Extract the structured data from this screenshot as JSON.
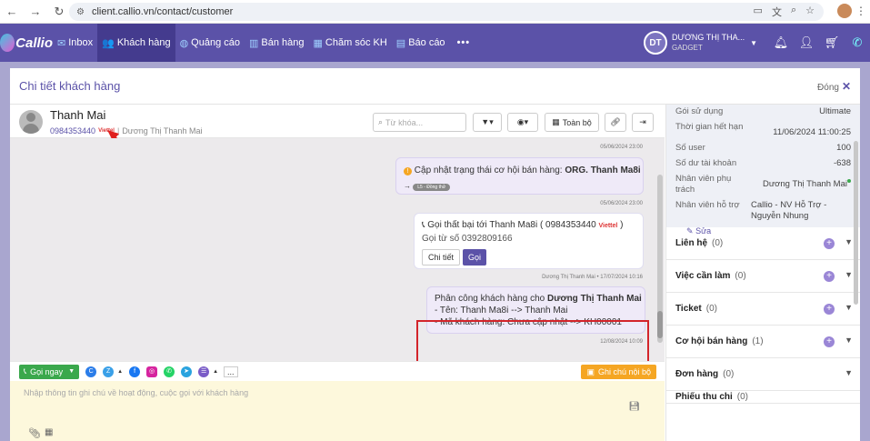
{
  "browser": {
    "url": "client.callio.vn/contact/customer"
  },
  "nav": {
    "logo": "Callio",
    "items": [
      "Inbox",
      "Khách hàng",
      "Quảng cáo",
      "Bán hàng",
      "Chăm sóc KH",
      "Báo cáo"
    ],
    "avatar": "DT",
    "user_name": "DƯƠNG THỊ THA...",
    "user_sub": "GADGET"
  },
  "panel": {
    "title": "Chi tiết khách hàng",
    "close": "Đóng"
  },
  "contact": {
    "name": "Thanh Mai",
    "phone": "0984353440",
    "carrier": "Viettel",
    "owner": "Dương Thị Thanh Mai"
  },
  "toolbar": {
    "search_placeholder": "Từ khóa...",
    "all": "Toàn bộ"
  },
  "feed": {
    "ts1": "05/06/2024 23:00",
    "status_text": "Cập nhật trạng thái cơ hội bán hàng:",
    "status_strong": "ORG. Thanh Ma8i",
    "status_tag": "L5 - Đồng thử",
    "ts2": "05/06/2024 23:00",
    "call_title": "Gọi thất bại tới Thanh Ma8i ( 0984353440",
    "call_carrier": "Viettel",
    "call_sub": "Gọi từ số 0392809166",
    "btn_detail": "Chi tiết",
    "btn_call": "Gọi",
    "ts3": "Dương Thị Thanh Mai • 17/07/2024 10:16",
    "assign_text": "Phân công khách hàng cho",
    "assign_strong": "Dương Thị Thanh Mai",
    "assign_l1": "- Tên: Thanh Ma8i --> Thanh Mai",
    "assign_l2": "- Mã khách hàng: Chưa cập nhật --> KH00001",
    "ts4": "12/08/2024 10:09"
  },
  "compose": {
    "call_now": "Gọi ngay",
    "internal_note": "Ghi chú nội bộ",
    "placeholder": "Nhập thông tin ghi chú về hoạt động, cuộc gọi với khách hàng",
    "more": "..."
  },
  "info": {
    "rows": [
      {
        "k": "Gói sử dụng",
        "v": "Ultimate"
      },
      {
        "k": "Thời gian hết hạn",
        "v": "11/06/2024 11:00:25"
      },
      {
        "k": "Số user",
        "v": "100"
      },
      {
        "k": "Số dư tài khoản",
        "v": "-638"
      },
      {
        "k": "Nhân viên phụ trách",
        "v": "Dương Thị Thanh Mai"
      },
      {
        "k": "Nhân viên hỗ trợ",
        "v": "Callio - NV Hỗ Trợ - Nguyễn Nhung"
      }
    ],
    "edit": "Sửa"
  },
  "sections": [
    {
      "label": "Liên hệ",
      "count": "(0)"
    },
    {
      "label": "Việc cần làm",
      "count": "(0)"
    },
    {
      "label": "Ticket",
      "count": "(0)"
    },
    {
      "label": "Cơ hội bán hàng",
      "count": "(1)"
    },
    {
      "label": "Đơn hàng",
      "count": "(0)"
    },
    {
      "label": "Phiếu thu chi",
      "count": "(0)"
    }
  ],
  "colors": {
    "brand": "#5b52a8",
    "highlight": "#d3242a",
    "call_green": "#3aa84c",
    "note_orange": "#f5a623"
  }
}
